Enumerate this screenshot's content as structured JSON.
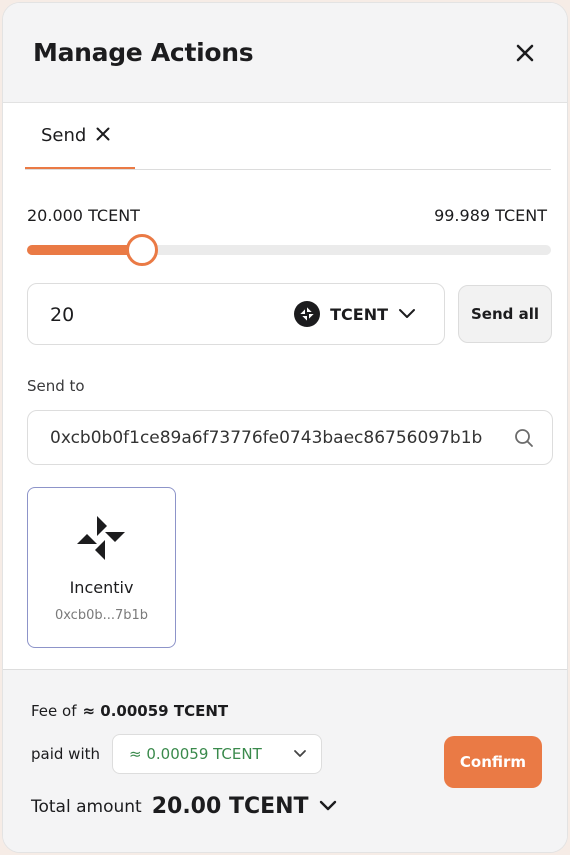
{
  "header": {
    "title": "Manage Actions",
    "close_icon": "close-icon"
  },
  "tabs": [
    {
      "label": "Send",
      "active": true,
      "icon": "close-icon"
    }
  ],
  "slider": {
    "min_label": "20.000 TCENT",
    "max_label": "99.989 TCENT",
    "fraction": 0.22,
    "accent_color": "#ea7a45"
  },
  "amount": {
    "value": "20",
    "token": "TCENT",
    "token_icon": "incentiv-logo-icon",
    "dropdown_icon": "chevron-down-icon"
  },
  "send_all_label": "Send all",
  "send_to": {
    "label": "Send to",
    "address": "0xcb0b0f1ce89a6f73776fe0743baec86756097b1b",
    "search_icon": "search-icon"
  },
  "contacts": [
    {
      "name": "Incentiv",
      "address": "0xcb0b...7b1b",
      "icon": "incentiv-logo-icon"
    }
  ],
  "footer": {
    "fee_label": "Fee of",
    "fee_value": "≈ 0.00059 TCENT",
    "paid_with_label": "paid with",
    "paid_with_value": "≈ 0.00059 TCENT",
    "paid_with_color": "#3a8a4c",
    "total_label": "Total amount",
    "total_value": "20.00 TCENT",
    "confirm_label": "Confirm"
  }
}
